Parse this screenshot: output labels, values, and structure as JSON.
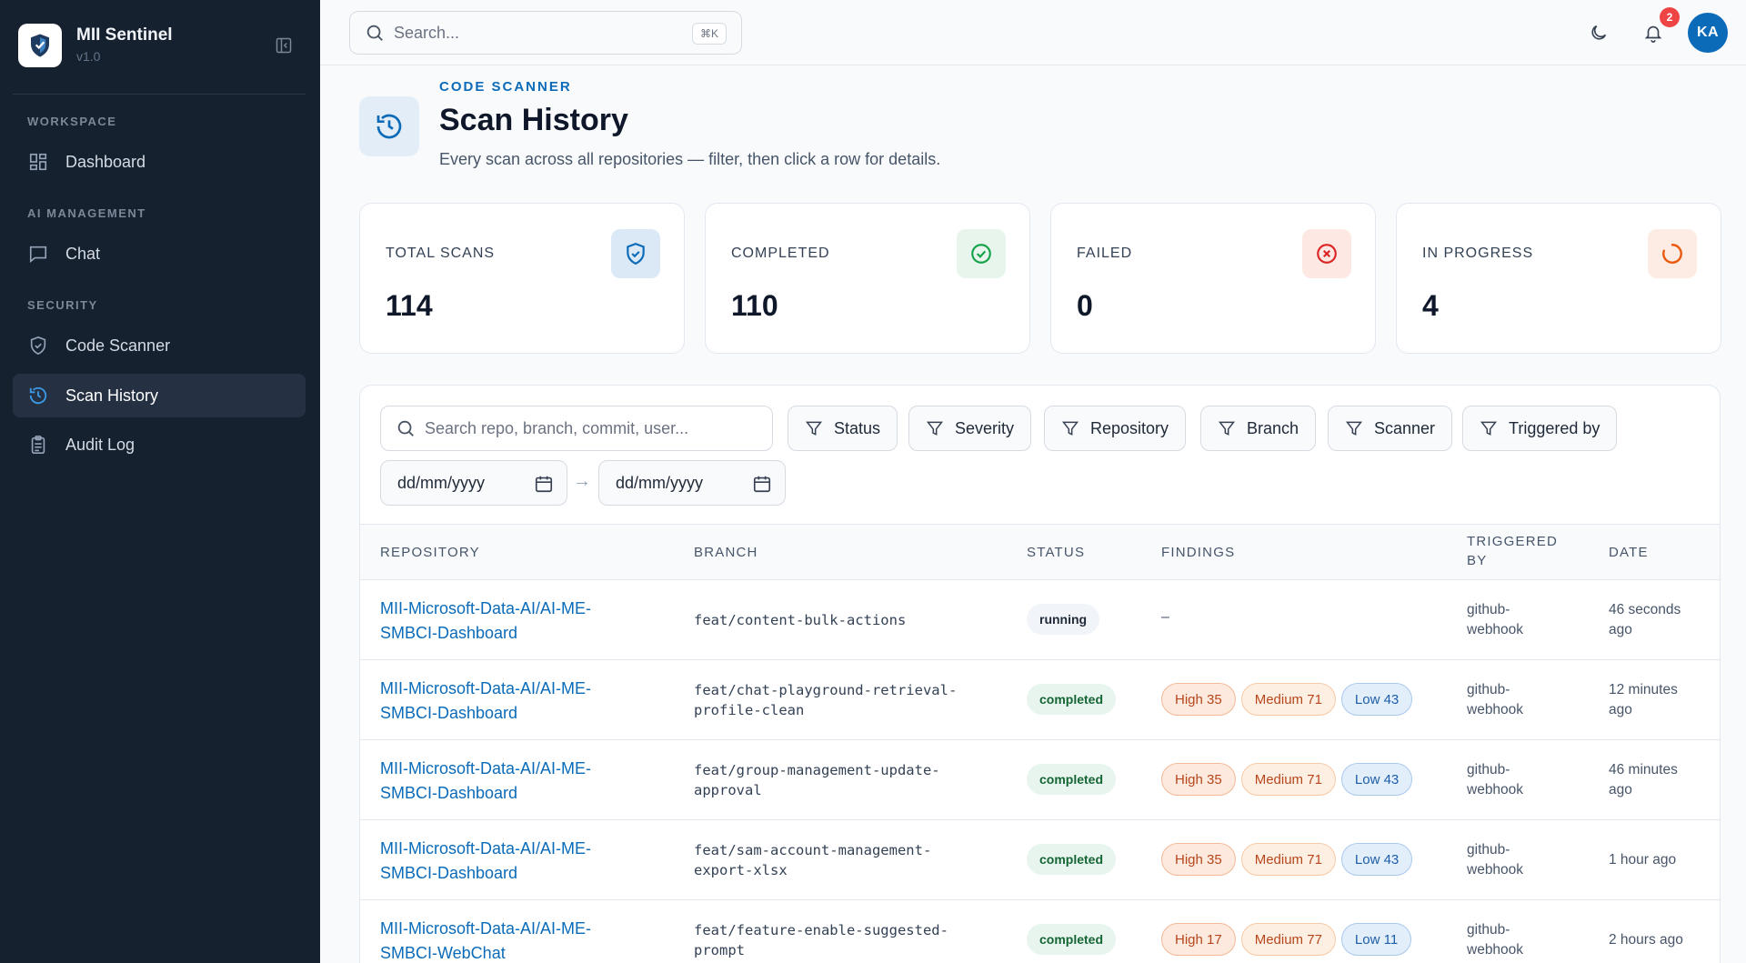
{
  "brand": {
    "name": "MII Sentinel",
    "version": "v1.0"
  },
  "sidebar": {
    "sections": [
      {
        "label": "WORKSPACE"
      },
      {
        "label": "AI MANAGEMENT"
      },
      {
        "label": "SECURITY"
      }
    ],
    "items": [
      {
        "label": "Dashboard",
        "icon": "grid-icon"
      },
      {
        "label": "Chat",
        "icon": "chat-icon"
      },
      {
        "label": "Code Scanner",
        "icon": "shield-icon"
      },
      {
        "label": "Scan History",
        "icon": "history-icon",
        "active": true
      },
      {
        "label": "Audit Log",
        "icon": "clipboard-icon"
      }
    ]
  },
  "topbar": {
    "search_placeholder": "Search...",
    "shortcut": "⌘K",
    "notification_count": "2",
    "avatar_initials": "KA"
  },
  "header": {
    "eyebrow": "CODE SCANNER",
    "title": "Scan History",
    "subtitle": "Every scan across all repositories — filter, then click a row for details."
  },
  "stats": [
    {
      "label": "TOTAL SCANS",
      "value": "114",
      "icon": "shield-check-icon",
      "color": "#0b6bb8"
    },
    {
      "label": "COMPLETED",
      "value": "110",
      "icon": "check-circle-icon",
      "color": "#16a34a"
    },
    {
      "label": "FAILED",
      "value": "0",
      "icon": "x-circle-icon",
      "color": "#dc2626"
    },
    {
      "label": "IN PROGRESS",
      "value": "4",
      "icon": "spinner-icon",
      "color": "#ea580c"
    }
  ],
  "filters": {
    "search_placeholder": "Search repo, branch, commit, user...",
    "chips": [
      "Status",
      "Severity",
      "Repository",
      "Branch",
      "Scanner",
      "Triggered by"
    ],
    "date_from": "dd/mm/yyyy",
    "date_to": "dd/mm/yyyy",
    "arrow": "→"
  },
  "table": {
    "headers": {
      "repository": "REPOSITORY",
      "branch": "BRANCH",
      "status": "STATUS",
      "findings": "FINDINGS",
      "triggered_by_1": "TRIGGERED",
      "triggered_by_2": "BY",
      "date": "DATE"
    },
    "rows": [
      {
        "repo_1": "MII-Microsoft-Data-AI/AI-ME-",
        "repo_2": "SMBCI-Dashboard",
        "branch_1": "feat/content-bulk-actions",
        "branch_2": "",
        "status": "running",
        "findings_empty": "–",
        "trig_1": "github-",
        "trig_2": "webhook",
        "date_1": "46 seconds",
        "date_2": "ago"
      },
      {
        "repo_1": "MII-Microsoft-Data-AI/AI-ME-",
        "repo_2": "SMBCI-Dashboard",
        "branch_1": "feat/chat-playground-retrieval-",
        "branch_2": "profile-clean",
        "status": "completed",
        "high": "High 35",
        "medium": "Medium 71",
        "low": "Low 43",
        "trig_1": "github-",
        "trig_2": "webhook",
        "date_1": "12 minutes",
        "date_2": "ago"
      },
      {
        "repo_1": "MII-Microsoft-Data-AI/AI-ME-",
        "repo_2": "SMBCI-Dashboard",
        "branch_1": "feat/group-management-update-",
        "branch_2": "approval",
        "status": "completed",
        "high": "High 35",
        "medium": "Medium 71",
        "low": "Low 43",
        "trig_1": "github-",
        "trig_2": "webhook",
        "date_1": "46 minutes",
        "date_2": "ago"
      },
      {
        "repo_1": "MII-Microsoft-Data-AI/AI-ME-",
        "repo_2": "SMBCI-Dashboard",
        "branch_1": "feat/sam-account-management-",
        "branch_2": "export-xlsx",
        "status": "completed",
        "high": "High 35",
        "medium": "Medium 71",
        "low": "Low 43",
        "trig_1": "github-",
        "trig_2": "webhook",
        "date_1": "1 hour ago",
        "date_2": ""
      },
      {
        "repo_1": "MII-Microsoft-Data-AI/AI-ME-",
        "repo_2": "SMBCI-WebChat",
        "branch_1": "feat/feature-enable-suggested-",
        "branch_2": "prompt",
        "status": "completed",
        "high": "High 17",
        "medium": "Medium 77",
        "low": "Low 11",
        "trig_1": "github-",
        "trig_2": "webhook",
        "date_1": "2 hours ago",
        "date_2": ""
      }
    ]
  }
}
